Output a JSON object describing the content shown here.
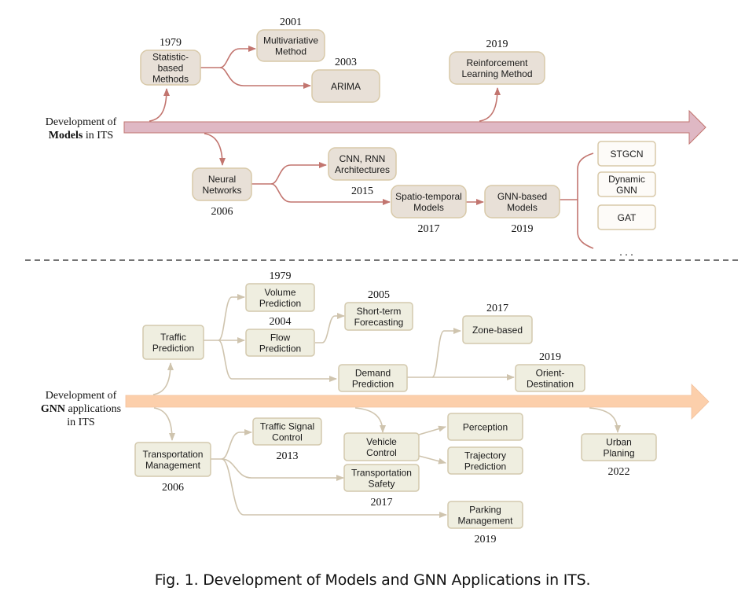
{
  "colors": {
    "models_arrow_fill": "#dfb8c4",
    "models_arrow_stroke": "#c2756f",
    "models_connector": "#c2756f",
    "models_node_fill": "#e8e0d7",
    "models_node_stroke": "#d8c9a9",
    "models_variant_fill": "#fdfbf8",
    "apps_arrow_fill": "#fccfab",
    "apps_connector": "#cfc4ae",
    "apps_node_fill": "#efeee0",
    "apps_node_stroke": "#d3c9ad",
    "separator": "#222222"
  },
  "models_section": {
    "axis_label_line1": "Development of",
    "axis_label_line2_bold": "Models",
    "axis_label_line2_rest": " in ITS",
    "nodes": [
      {
        "id": "statistic",
        "lines": [
          "Statistic-",
          "based",
          "Methods"
        ],
        "year": "1979"
      },
      {
        "id": "multivariative",
        "lines": [
          "Multivariative",
          "Method"
        ],
        "year": "2001"
      },
      {
        "id": "arima",
        "lines": [
          "ARIMA"
        ],
        "year": "2003"
      },
      {
        "id": "reinforcement",
        "lines": [
          "Reinforcement",
          "Learning Method"
        ],
        "year": "2019"
      },
      {
        "id": "neural",
        "lines": [
          "Neural",
          "Networks"
        ],
        "year": "2006"
      },
      {
        "id": "cnn-rnn",
        "lines": [
          "CNN, RNN",
          "Architectures"
        ],
        "year": "2015"
      },
      {
        "id": "spatio-temporal",
        "lines": [
          "Spatio-temporal",
          "Models"
        ],
        "year": "2017"
      },
      {
        "id": "gnn-based",
        "lines": [
          "GNN-based",
          "Models"
        ],
        "year": "2019"
      }
    ],
    "gnn_variants": [
      {
        "id": "stgcn",
        "lines": [
          "STGCN"
        ]
      },
      {
        "id": "dynamic-gnn",
        "lines": [
          "Dynamic",
          "GNN"
        ]
      },
      {
        "id": "gat",
        "lines": [
          "GAT"
        ]
      }
    ],
    "ellipsis": ". . ."
  },
  "apps_section": {
    "axis_label_line1": "Development of",
    "axis_label_line2_bold": "GNN",
    "axis_label_line2_rest": " applications",
    "axis_label_line3": "in ITS",
    "nodes": [
      {
        "id": "traffic-prediction",
        "lines": [
          "Traffic",
          "Prediction"
        ],
        "year": ""
      },
      {
        "id": "volume-prediction",
        "lines": [
          "Volume",
          "Prediction"
        ],
        "year": "1979"
      },
      {
        "id": "flow-prediction",
        "lines": [
          "Flow",
          "Prediction"
        ],
        "year": "2004"
      },
      {
        "id": "short-term",
        "lines": [
          "Short-term",
          "Forecasting"
        ],
        "year": "2005"
      },
      {
        "id": "demand-prediction",
        "lines": [
          "Demand",
          "Prediction"
        ],
        "year": ""
      },
      {
        "id": "zone-based",
        "lines": [
          "Zone-based"
        ],
        "year": "2017"
      },
      {
        "id": "orient-destination",
        "lines": [
          "Orient-",
          "Destination"
        ],
        "year": "2019"
      },
      {
        "id": "transportation-management",
        "lines": [
          "Transportation",
          "Management"
        ],
        "year": "2006"
      },
      {
        "id": "traffic-signal",
        "lines": [
          "Traffic Signal",
          "Control"
        ],
        "year": "2013"
      },
      {
        "id": "vehicle-control",
        "lines": [
          "Vehicle",
          "Control"
        ],
        "year": ""
      },
      {
        "id": "transportation-safety",
        "lines": [
          "Transportation",
          "Safety"
        ],
        "year": "2017"
      },
      {
        "id": "perception",
        "lines": [
          "Perception"
        ],
        "year": ""
      },
      {
        "id": "trajectory",
        "lines": [
          "Trajectory",
          "Prediction"
        ],
        "year": ""
      },
      {
        "id": "parking",
        "lines": [
          "Parking",
          "Management"
        ],
        "year": "2019"
      },
      {
        "id": "urban-planing",
        "lines": [
          "Urban",
          "Planing"
        ],
        "year": "2022"
      }
    ]
  },
  "caption": "Fig. 1.  Development of Models and GNN Applications in ITS."
}
